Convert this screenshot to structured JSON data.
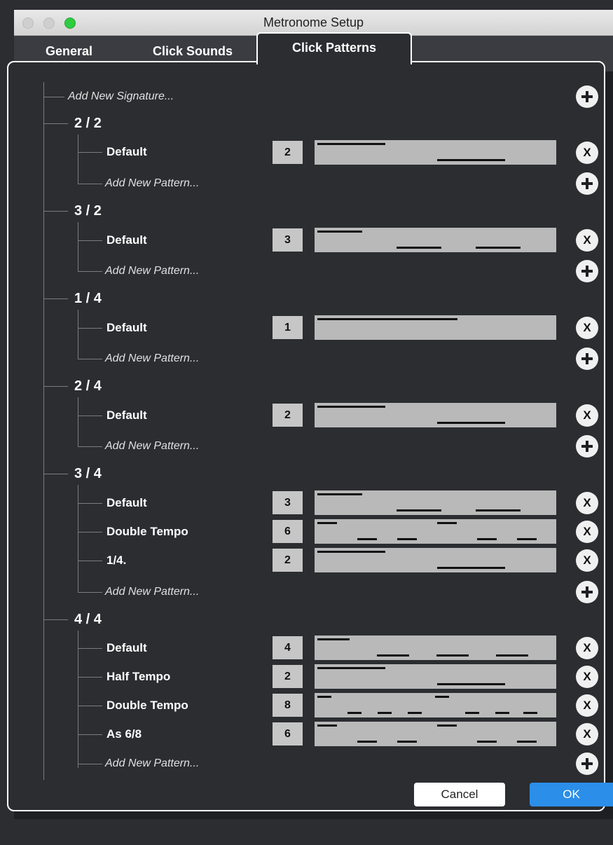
{
  "window": {
    "title": "Metronome Setup"
  },
  "tabs": [
    "General",
    "Click Sounds",
    "Click Patterns"
  ],
  "add_signature": "Add New Signature...",
  "add_pattern": "Add New Pattern...",
  "signatures": [
    {
      "label": "2 / 2",
      "patterns": [
        {
          "name": "Default",
          "count": "2"
        }
      ]
    },
    {
      "label": "3 / 2",
      "patterns": [
        {
          "name": "Default",
          "count": "3"
        }
      ]
    },
    {
      "label": "1 / 4",
      "patterns": [
        {
          "name": "Default",
          "count": "1"
        }
      ]
    },
    {
      "label": "2 / 4",
      "patterns": [
        {
          "name": "Default",
          "count": "2"
        }
      ]
    },
    {
      "label": "3 / 4",
      "patterns": [
        {
          "name": "Default",
          "count": "3"
        },
        {
          "name": "Double Tempo",
          "count": "6"
        },
        {
          "name": "1/4.",
          "count": "2"
        }
      ]
    },
    {
      "label": "4 / 4",
      "patterns": [
        {
          "name": "Default",
          "count": "4"
        },
        {
          "name": "Half Tempo",
          "count": "2"
        },
        {
          "name": "Double Tempo",
          "count": "8"
        },
        {
          "name": "As 6/8",
          "count": "6"
        }
      ]
    }
  ],
  "remove_label": "X",
  "buttons": {
    "cancel": "Cancel",
    "ok": "OK"
  }
}
